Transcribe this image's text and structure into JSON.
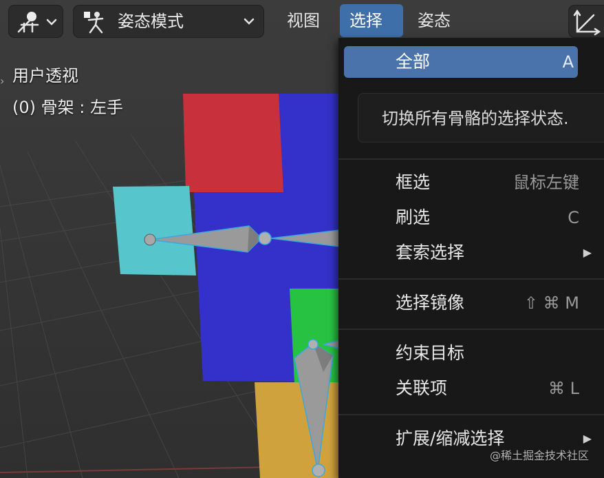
{
  "header": {
    "mode_label": "姿态模式",
    "menus": [
      {
        "label": "视图"
      },
      {
        "label": "选择"
      },
      {
        "label": "姿态"
      }
    ]
  },
  "overlay": {
    "view_name": "用户透视",
    "object_info": "(0) 骨架 : 左手"
  },
  "select_menu": {
    "items": {
      "all": {
        "label": "全部",
        "shortcut": "A"
      },
      "box": {
        "label": "框选",
        "shortcut": "鼠标左键"
      },
      "circle": {
        "label": "刷选",
        "shortcut": "C"
      },
      "lasso": {
        "label": "套索选择"
      },
      "mirror": {
        "label": "选择镜像",
        "shortcut": "⇧ ⌘ M"
      },
      "constraint": {
        "label": "约束目标"
      },
      "linked": {
        "label": "关联项",
        "shortcut": "⌘ L"
      },
      "grow": {
        "label": "扩展/缩减选择"
      }
    }
  },
  "tooltip": {
    "text": "切换所有骨骼的选择状态."
  },
  "watermark": "@稀土掘金技术社区",
  "colors": {
    "accent": "#4a73ab",
    "red_face": "#c8313c",
    "blue_face": "#3331c9",
    "cyan_face": "#56c6cc",
    "green_face": "#28c243",
    "yellow_face": "#cfa23d"
  }
}
